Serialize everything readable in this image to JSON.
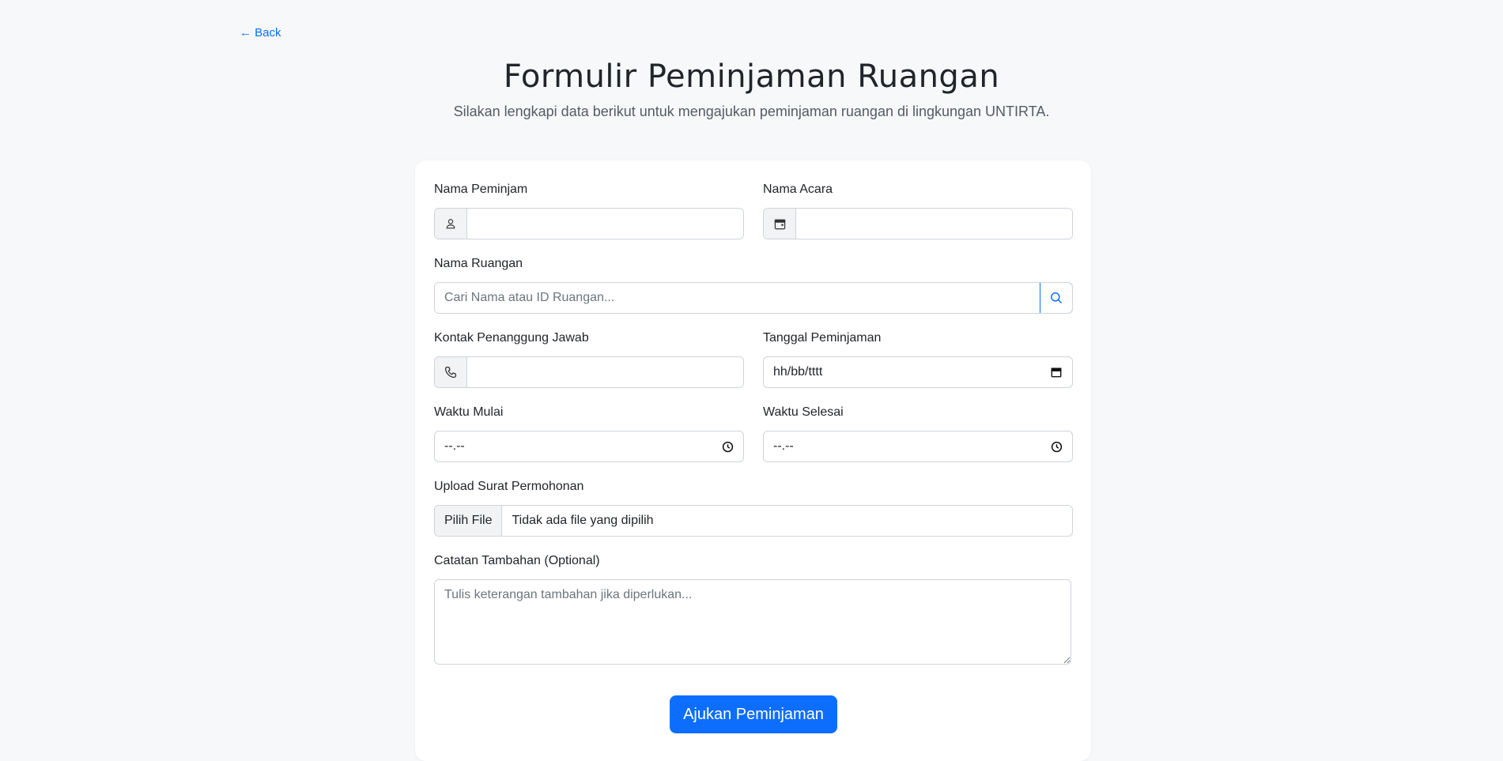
{
  "nav": {
    "back_label": "← Back"
  },
  "header": {
    "title": "Formulir Peminjaman Ruangan",
    "subtitle": "Silakan lengkapi data berikut untuk mengajukan peminjaman ruangan di lingkungan UNTIRTA."
  },
  "form": {
    "borrower_name": {
      "label": "Nama Peminjam",
      "value": "",
      "icon": "person-icon"
    },
    "event_name": {
      "label": "Nama Acara",
      "value": "",
      "icon": "calendar-icon"
    },
    "room_name": {
      "label": "Nama Ruangan",
      "placeholder": "Cari Nama atau ID Ruangan...",
      "icon": "search-icon"
    },
    "contact": {
      "label": "Kontak Penanggung Jawab",
      "value": "",
      "icon": "phone-icon"
    },
    "date": {
      "label": "Tanggal Peminjaman",
      "value": "hh/bb/tttt",
      "icon": "calendar-icon"
    },
    "start_time": {
      "label": "Waktu Mulai",
      "value": "--.--",
      "icon": "clock-icon"
    },
    "end_time": {
      "label": "Waktu Selesai",
      "value": "--.--",
      "icon": "clock-icon"
    },
    "upload": {
      "label": "Upload Surat Permohonan",
      "button_label": "Pilih File",
      "status": "Tidak ada file yang dipilih"
    },
    "notes": {
      "label": "Catatan Tambahan (Optional)",
      "placeholder": "Tulis keterangan tambahan jika diperlukan..."
    },
    "submit_label": "Ajukan Peminjaman"
  },
  "colors": {
    "accent": "#0d6efd",
    "background": "#f7f8fa",
    "card": "#ffffff"
  }
}
